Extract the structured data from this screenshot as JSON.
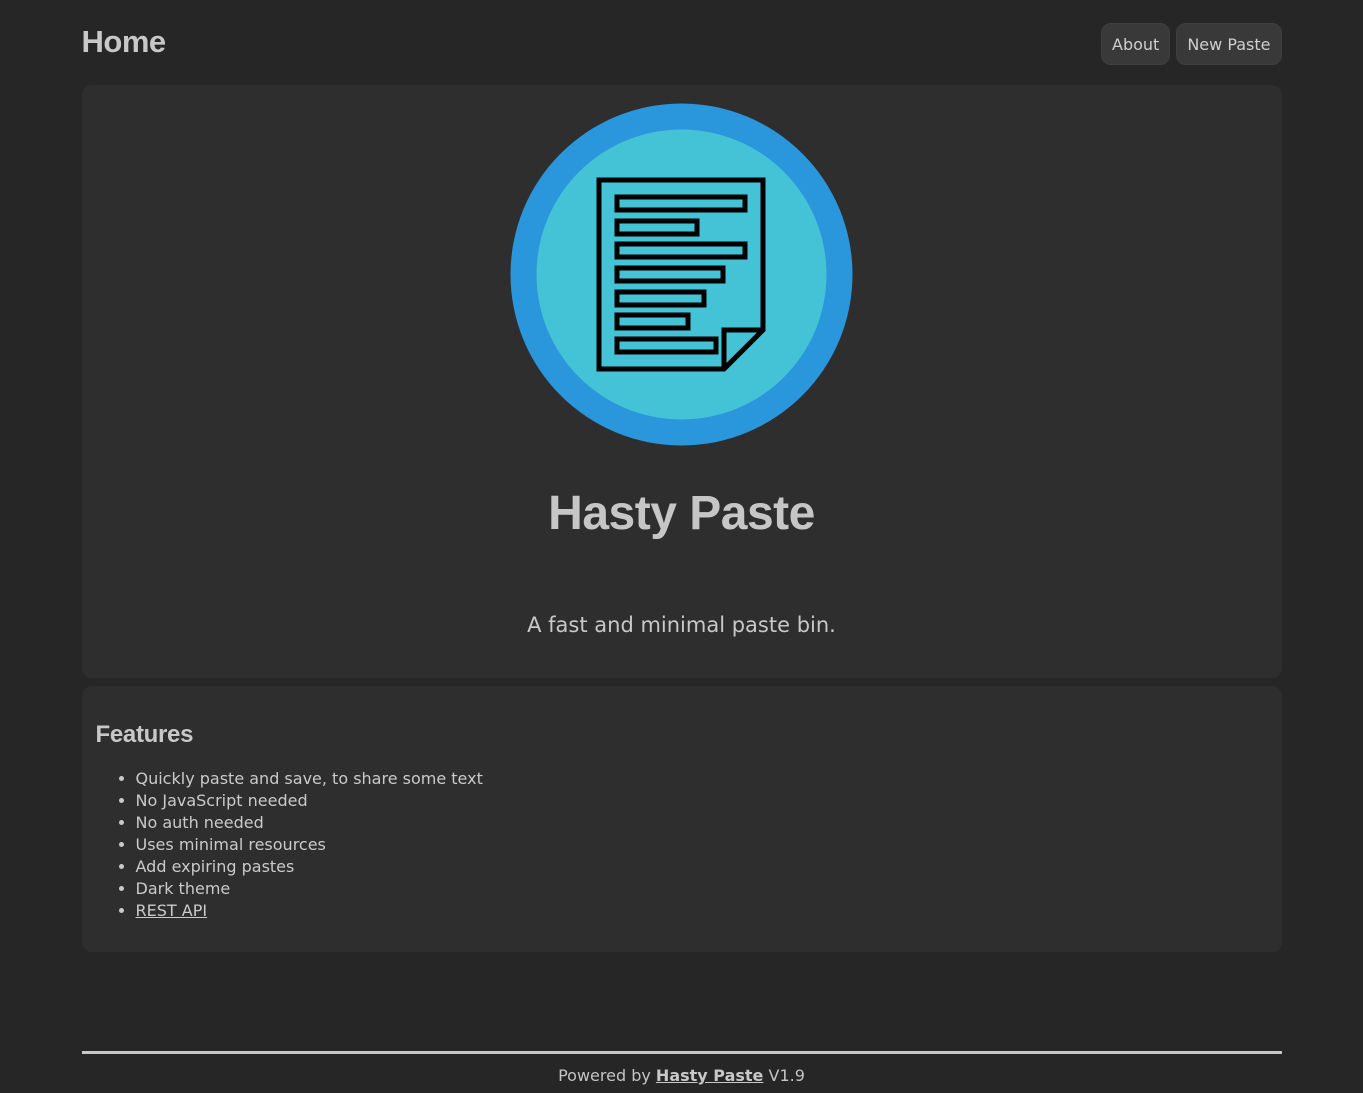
{
  "header": {
    "title": "Home",
    "nav": [
      {
        "label": "About"
      },
      {
        "label": "New Paste"
      }
    ]
  },
  "hero": {
    "logo_icon": "document-icon",
    "title": "Hasty Paste",
    "tagline": "A fast and minimal paste bin."
  },
  "features": {
    "heading": "Features",
    "items": [
      "Quickly paste and save, to share some text",
      "No JavaScript needed",
      "No auth needed",
      "Uses minimal resources",
      "Add expiring pastes",
      "Dark theme",
      "REST API"
    ]
  },
  "footer": {
    "prefix": "Powered by",
    "link": "Hasty Paste",
    "version": "V1.9"
  },
  "colors": {
    "background": "#262626",
    "card": "#2e2e2e",
    "logo_outer": "#2a96dc",
    "logo_inner": "#45c3d6"
  }
}
